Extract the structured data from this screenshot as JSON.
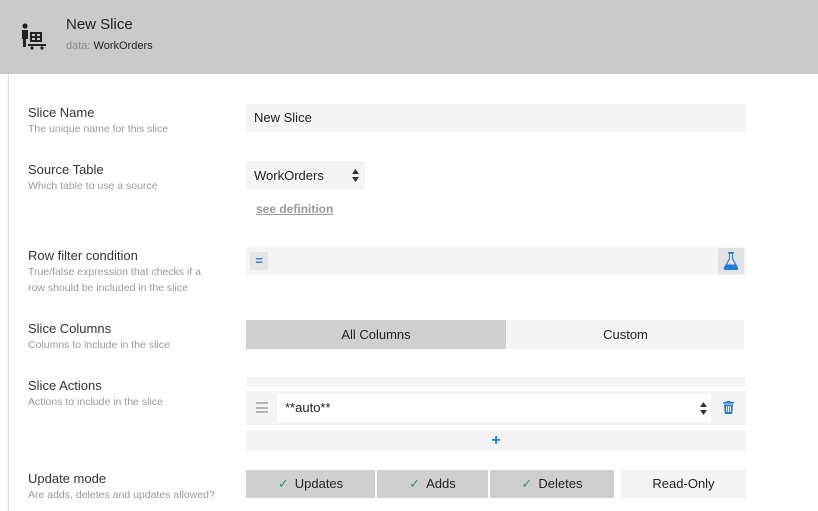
{
  "header": {
    "title": "New Slice",
    "data_label": "data:",
    "data_value": "WorkOrders",
    "icon": "table-cart-icon"
  },
  "fields": {
    "slice_name": {
      "title": "Slice Name",
      "desc": "The unique name for this slice",
      "value": "New Slice"
    },
    "source_table": {
      "title": "Source Table",
      "desc": "Which table to use a source",
      "value": "WorkOrders",
      "link": "see definition"
    },
    "row_filter": {
      "title": "Row filter condition",
      "desc_line1": "True/false expression that checks if a",
      "desc_line2": "row should be included in the slice",
      "eq_symbol": "=",
      "value": ""
    },
    "slice_columns": {
      "title": "Slice Columns",
      "desc": "Columns to include in the slice",
      "options": [
        "All Columns",
        "Custom"
      ],
      "selected": "All Columns"
    },
    "slice_actions": {
      "title": "Slice Actions",
      "desc": "Actions to include in the slice",
      "item_value": "**auto**",
      "add_symbol": "+"
    },
    "update_mode": {
      "title": "Update mode",
      "desc": "Are adds, deletes and updates allowed?",
      "options": [
        "Updates",
        "Adds",
        "Deletes",
        "Read-Only"
      ],
      "check_symbol": "✓",
      "selected": [
        "Updates",
        "Adds",
        "Deletes"
      ]
    }
  },
  "colors": {
    "header_bg": "#cacaca",
    "accent": "#1f7ed6",
    "check": "#2aa44a",
    "selected_bg": "#cfcfcf",
    "input_bg": "#f4f4f4"
  }
}
